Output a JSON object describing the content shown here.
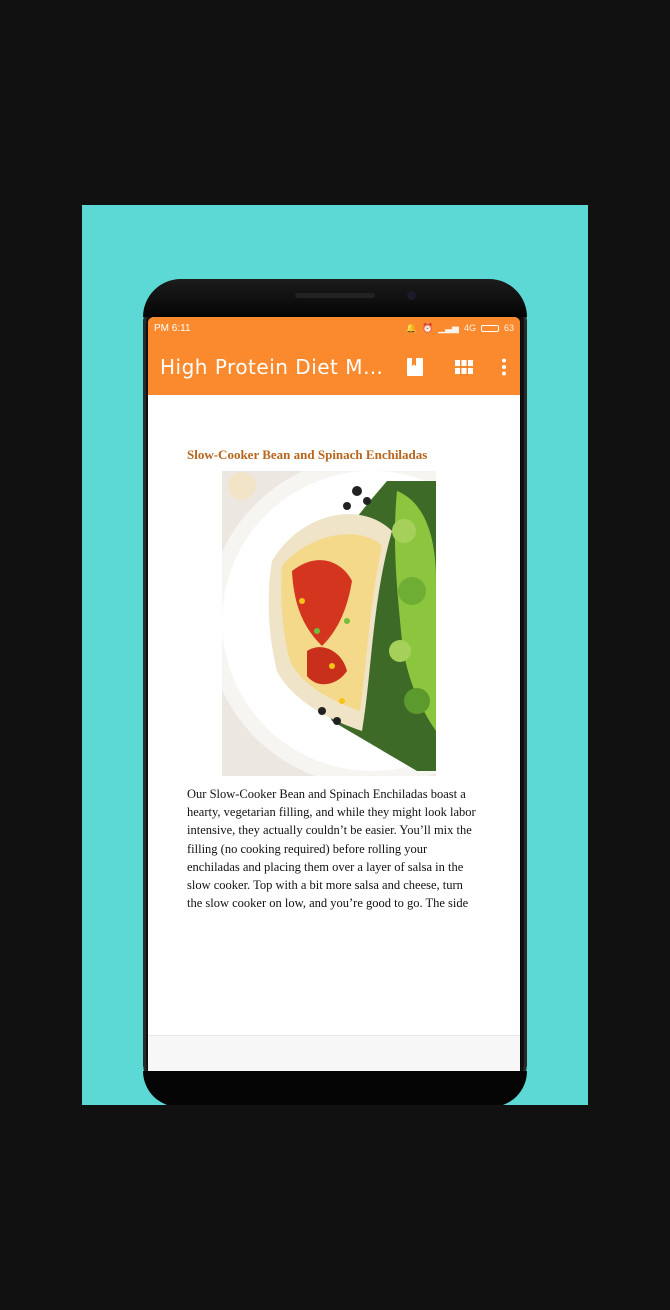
{
  "status_bar": {
    "time": "PM 6:11",
    "network": "4G",
    "battery": "63"
  },
  "app_bar": {
    "title": "High Protein Diet Mea…"
  },
  "recipe": {
    "title": "Slow-Cooker Bean and Spinach Enchiladas",
    "paragraph_lines": [
      "Our Slow-Cooker Bean and Spinach Enchiladas boast a",
      "hearty, vegetarian filling, and while they might look labor",
      "intensive, they actually couldn’t be easier. You’ll mix the",
      "filling (no cooking required) before rolling your",
      "enchiladas and placing them over a layer of salsa in the",
      "slow cooker. Top with a bit more salsa and cheese, turn",
      "the slow cooker on low, and you’re good to go. The side"
    ]
  },
  "icons": {
    "bookmark": "bookmark-icon",
    "grid": "grid-view-icon",
    "menu": "more-vert-icon"
  },
  "colors": {
    "background": "#111111",
    "promo_card": "#5dd9d5",
    "app_bar": "#fb8a2e",
    "recipe_title": "#b8651d"
  }
}
